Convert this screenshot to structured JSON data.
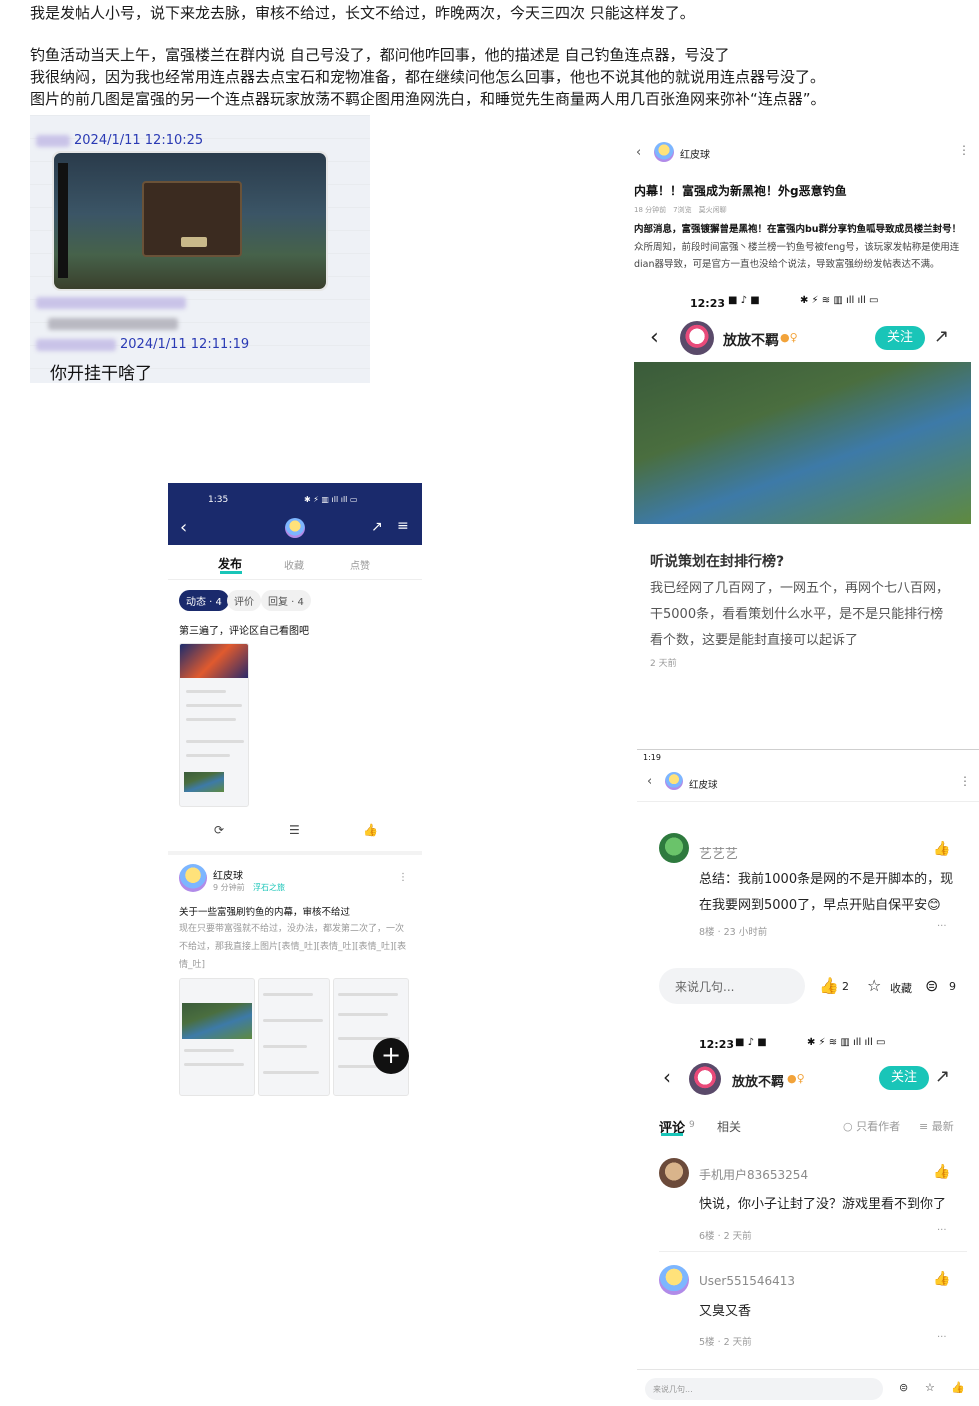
{
  "intro": {
    "line1": "我是发帖人小号，说下来龙去脉，审核不给过，长文不给过，昨晚两次，今天三四次 只能这样发了。",
    "line2": "钓鱼活动当天上午，富强楼兰在群内说 自己号没了，都问他咋回事，他的描述是 自己钓鱼连点器，号没了",
    "line3": "我很纳闷，因为我也经常用连点器去点宝石和宠物准备，都在继续问他怎么回事，他也不说其他的就说用连点器号没了。",
    "line4": "图片的前几图是富强的另一个连点器玩家放荡不羁企图用渔网洗白，和睡觉先生商量两人用几百张渔网来弥补“连点器”。"
  },
  "chat": {
    "time1": "2024/1/11 12:10:25",
    "time2": "2024/1/11 12:11:19",
    "message": "你开挂干啥了"
  },
  "post_top": {
    "header_name": "红皮球",
    "title": "内幕！！富强成为新黑袍！外g恶意钓鱼",
    "meta": "18 分钟前　7浏览　莫火闲聊",
    "lead": "内部消息，富强镀獬曾是黑袍！在富强内bu群分享钓鱼呱导致成员楼兰封号！",
    "body": "众所周知，前段时间富强丶楼兰榜一钓鱼号被feng号，该玩家发帖称是使用连dian器导致，可是官方一直也没给个说法，导致富强纷纷发帖表达不满。",
    "status_time": "12:23",
    "author": "放放不羁",
    "follow": "关注",
    "q_title": "听说策划在封排行榜?",
    "q_body": "我已经网了几百网了，一网五个，再网个七八百网，干5000条，看看策划什么水平，是不是只能排行榜看个数，这要是能封直接可以起诉了",
    "q_time": "2 天前"
  },
  "profile": {
    "status_time": "1:35",
    "tabs": [
      "发布",
      "收藏",
      "点赞"
    ],
    "chips": [
      "动态 · 4",
      "评价",
      "回复 · 4"
    ],
    "post1_text": "第三遍了，评论区自己看图吧",
    "author": "红皮球",
    "time": "9 分钟前",
    "circle": "浮石之旅",
    "post2_title": "关于一些富强刷钓鱼的内幕，审核不给过",
    "post2_body": "现在只要带富强就不给过，没办法，都发第二次了，一次不给过，那我直接上图片[表情_吐][表情_吐][表情_吐][表情_吐]",
    "fab": "+"
  },
  "comments": {
    "status_time": "1:19",
    "header_name": "红皮球",
    "c1_user": "艺艺艺",
    "c1_text": "总结：我前1000条是网的不是开脚本的，现在我要网到5000了，早点开贴自保平安😊",
    "c1_meta": "8楼 · 23 小时前",
    "input_placeholder": "来说几句...",
    "likes": "2",
    "collect": "收藏",
    "comment_count": "9",
    "status_time2": "12:23",
    "author": "放放不羁",
    "follow": "关注",
    "tab_comments": "评论",
    "tab_count": "9",
    "tab_related": "相关",
    "only_author": "只看作者",
    "newest": "最新",
    "c2_user": "手机用户83653254",
    "c2_text": "快说，你小子让封了没？游戏里看不到你了",
    "c2_meta": "6楼 · 2 天前",
    "c3_user": "User551546413",
    "c3_text": "又臭又香",
    "c3_meta": "5楼 · 2 天前",
    "bottom_placeholder": "来说几句..."
  },
  "colors": {
    "teal": "#19c5b8",
    "navy": "#1a2a6c",
    "link": "#2a3ab4"
  }
}
